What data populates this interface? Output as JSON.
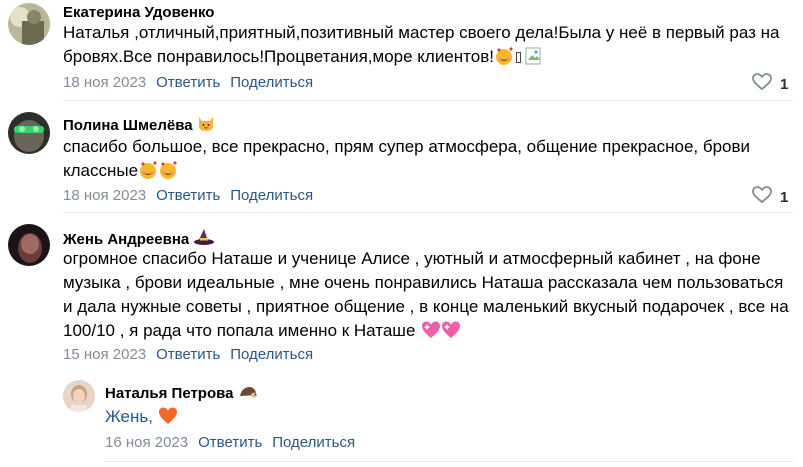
{
  "comments": [
    {
      "author": "Екатерина Удовенко",
      "text_line1": "Наталья ,отличный,приятный,позитивный мастер своего дела!Была у неё в первый раз на",
      "text_line2": "бровях.Все понравилось!Процветания,море клиентов!",
      "date": "18 ноя 2023",
      "reply": "Ответить",
      "share": "Поделиться",
      "likes": "1"
    },
    {
      "author": "Полина Шмелёва",
      "text_line1": "спасибо большое, все прекрасно, прям супер атмосфера, общение прекрасное, брови",
      "text_line2": "классные",
      "date": "18 ноя 2023",
      "reply": "Ответить",
      "share": "Поделиться",
      "likes": "1"
    },
    {
      "author": "Жень Андреевна",
      "text_line1": "огромное спасибо Наташе и ученице Алисе , уютный и атмосферный кабинет , на фоне",
      "text_line2": "музыка , брови идеальные , мне очень понравились Наташа рассказала чем пользоваться",
      "text_line3": "и дала нужные советы , приятное общение , в конце маленький вкусный подарочек , все на",
      "text_line4": "100/10 , я рада что попала именно к Наташе",
      "date": "15 ноя 2023",
      "reply": "Ответить",
      "share": "Поделиться"
    }
  ],
  "reply_comment": {
    "author": "Наталья Петрова",
    "name_ref": "Жень,",
    "date": "16 ноя 2023",
    "reply": "Ответить",
    "share": "Поделиться"
  },
  "icons": {
    "like": "heart-outline-icon",
    "smiling_hearts": "smiling-face-with-hearts-emoji",
    "cat": "cat-face-emoji",
    "witch_hat": "witch-hat-emoji",
    "sparkling_heart": "sparkling-heart-emoji",
    "red_heart": "red-heart-emoji",
    "hedgehog": "hedgehog-emoji"
  },
  "colors": {
    "link": "#2a5885",
    "muted": "#818c99",
    "divider": "#e7e8ec"
  }
}
